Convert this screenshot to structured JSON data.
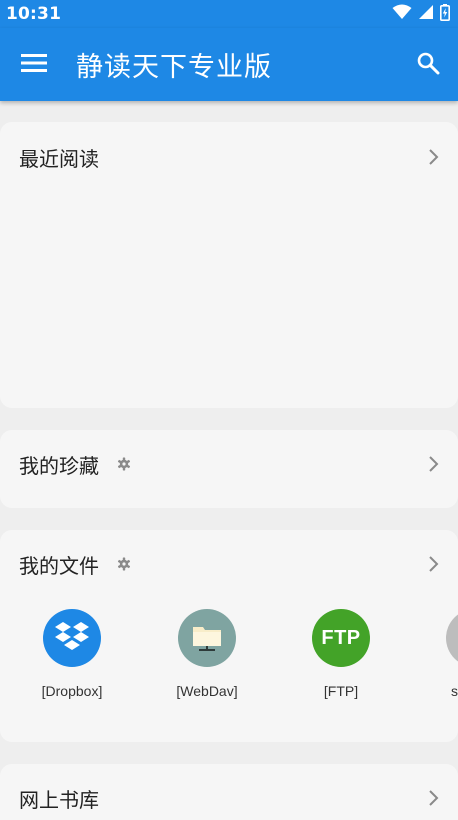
{
  "status_bar": {
    "time": "10:31"
  },
  "app_bar": {
    "title": "静读天下专业版"
  },
  "sections": {
    "recent": {
      "title": "最近阅读"
    },
    "favorites": {
      "title": "我的珍藏"
    },
    "files": {
      "title": "我的文件",
      "sources": [
        {
          "label": "[Dropbox]",
          "color": "#1e88e5"
        },
        {
          "label": "[WebDav]",
          "color": "#7fa4a1"
        },
        {
          "label": "[FTP]",
          "color": "#43a328",
          "icon_text": "FTP"
        },
        {
          "label": "s",
          "color": "#bdbdbd"
        }
      ]
    },
    "online": {
      "title": "网上书库"
    }
  },
  "colors": {
    "primary": "#1e88e5",
    "card_bg": "#f6f6f6",
    "page_bg": "#eeeeee"
  }
}
